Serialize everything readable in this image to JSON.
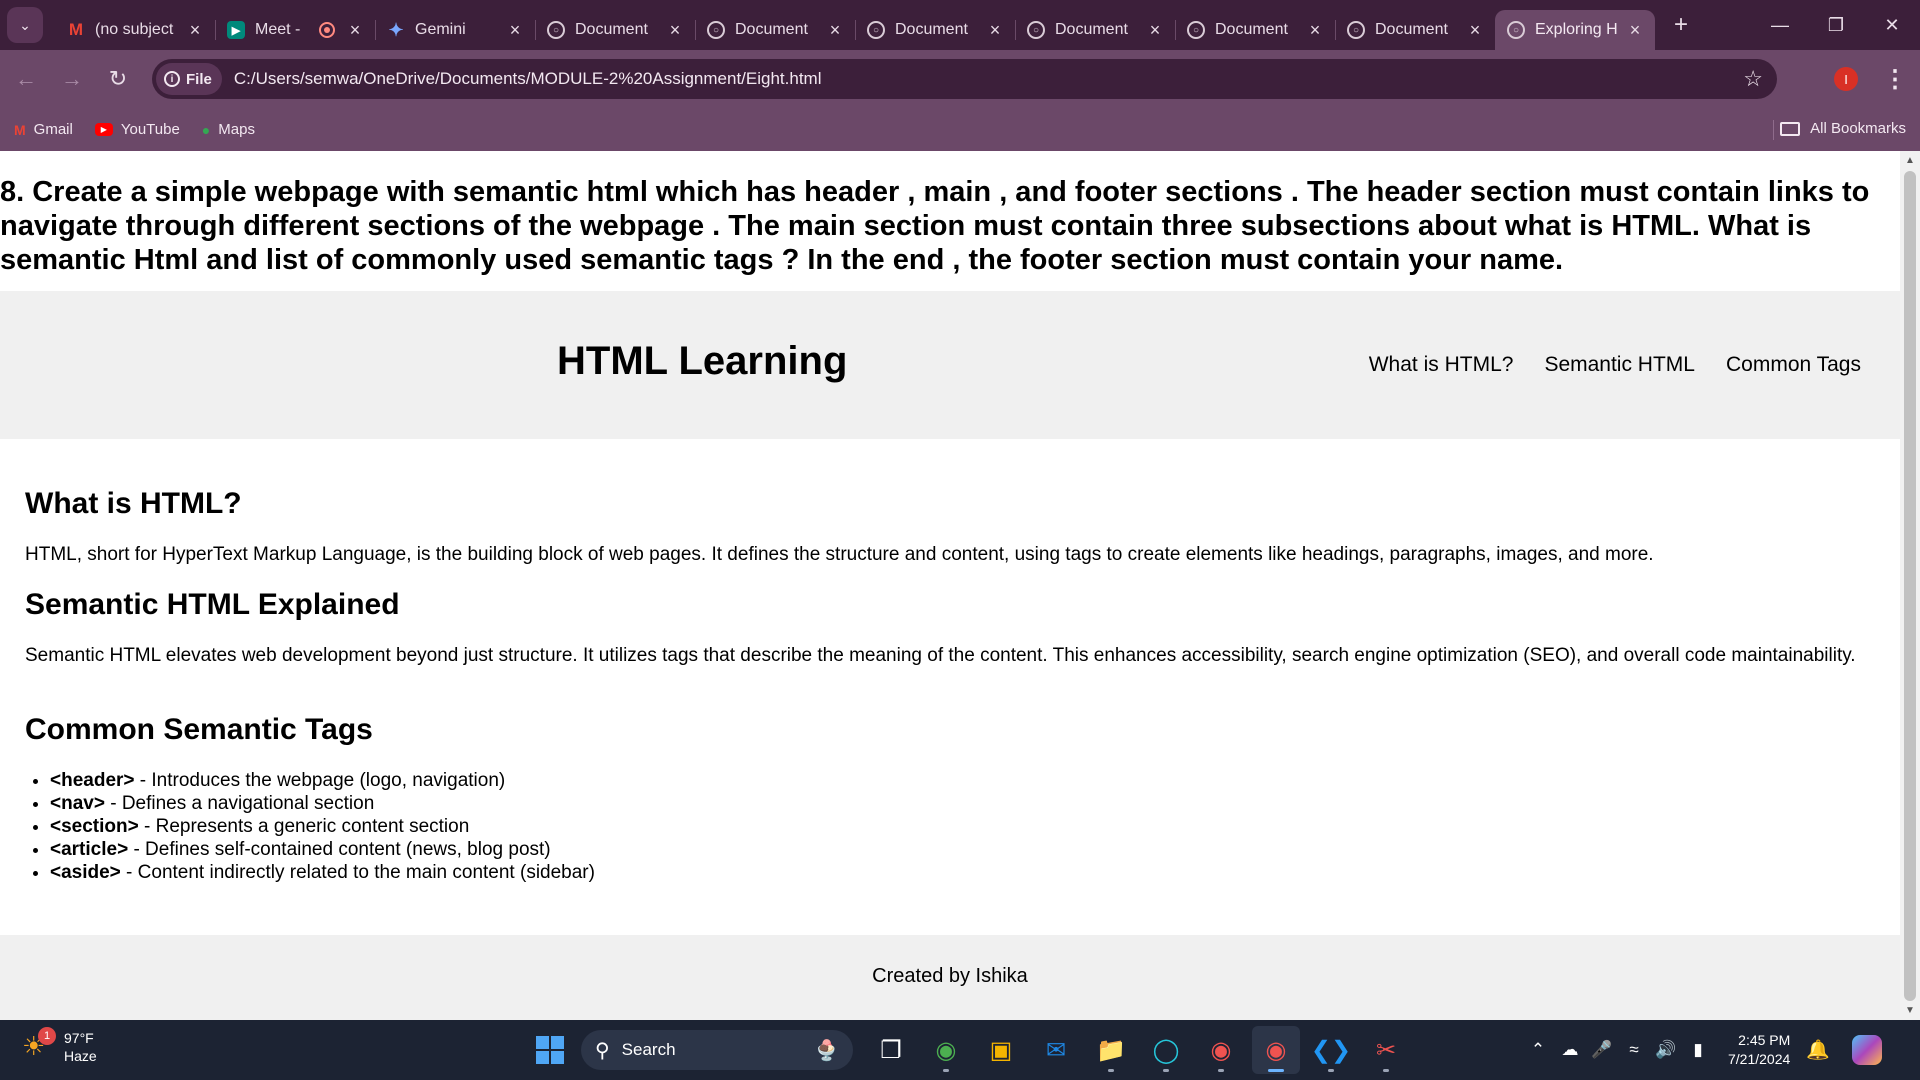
{
  "browser": {
    "tabs": [
      {
        "title": "(no subject",
        "favicon": "gmail-icon",
        "active": false
      },
      {
        "title": "Meet -",
        "favicon": "meet-icon",
        "active": false,
        "recording": true
      },
      {
        "title": "Gemini",
        "favicon": "gemini-icon",
        "active": false
      },
      {
        "title": "Document",
        "favicon": "globe-icon",
        "active": false
      },
      {
        "title": "Document",
        "favicon": "globe-icon",
        "active": false
      },
      {
        "title": "Document",
        "favicon": "globe-icon",
        "active": false
      },
      {
        "title": "Document",
        "favicon": "globe-icon",
        "active": false
      },
      {
        "title": "Document",
        "favicon": "globe-icon",
        "active": false
      },
      {
        "title": "Document",
        "favicon": "globe-icon",
        "active": false
      },
      {
        "title": "Exploring H",
        "favicon": "globe-icon",
        "active": true
      }
    ],
    "site_chip": "File",
    "url": "C:/Users/semwa/OneDrive/Documents/MODULE-2%20Assignment/Eight.html",
    "profile_initial": "I",
    "bookmarks": [
      {
        "label": "Gmail",
        "icon": "gmail-icon"
      },
      {
        "label": "YouTube",
        "icon": "youtube-icon"
      },
      {
        "label": "Maps",
        "icon": "maps-icon"
      }
    ],
    "all_bookmarks": "All Bookmarks",
    "accent_color": "#6b4868"
  },
  "page": {
    "task": "8. Create a simple webpage with semantic html which has header , main , and footer sections . The header section must contain links to navigate through different sections of the webpage . The main section must contain three subsections about what is HTML. What is semantic Html and list of commonly used semantic tags ? In the end , the footer section must contain your name.",
    "header": {
      "title": "HTML Learning",
      "nav": [
        "What is HTML?",
        "Semantic HTML",
        "Common Tags"
      ]
    },
    "sections": [
      {
        "heading": "What is HTML?",
        "text": "HTML, short for HyperText Markup Language, is the building block of web pages. It defines the structure and content, using tags to create elements like headings, paragraphs, images, and more."
      },
      {
        "heading": "Semantic HTML Explained",
        "text": "Semantic HTML elevates web development beyond just structure. It utilizes tags that describe the meaning of the content. This enhances accessibility, search engine optimization (SEO), and overall code maintainability."
      },
      {
        "heading": "Common Semantic Tags",
        "items": [
          {
            "tag": "<header>",
            "desc": " - Introduces the webpage (logo, navigation)"
          },
          {
            "tag": "<nav>",
            "desc": " - Defines a navigational section"
          },
          {
            "tag": "<section>",
            "desc": " - Represents a generic content section"
          },
          {
            "tag": "<article>",
            "desc": " - Defines self-contained content (news, blog post)"
          },
          {
            "tag": "<aside>",
            "desc": " - Content indirectly related to the main content (sidebar)"
          }
        ]
      }
    ],
    "footer": "Created by Ishika"
  },
  "taskbar": {
    "weather": {
      "temp": "97°F",
      "condition": "Haze",
      "badge": "1"
    },
    "search_label": "Search",
    "apps": [
      "task-view-icon",
      "chrome-icon",
      "store-icon",
      "outlook-icon",
      "file-explorer-icon",
      "edge-icon",
      "chrome-profile-icon",
      "chrome-active-icon",
      "vscode-icon",
      "snipping-tool-icon"
    ],
    "clock": {
      "time": "2:45 PM",
      "date": "7/21/2024"
    }
  }
}
